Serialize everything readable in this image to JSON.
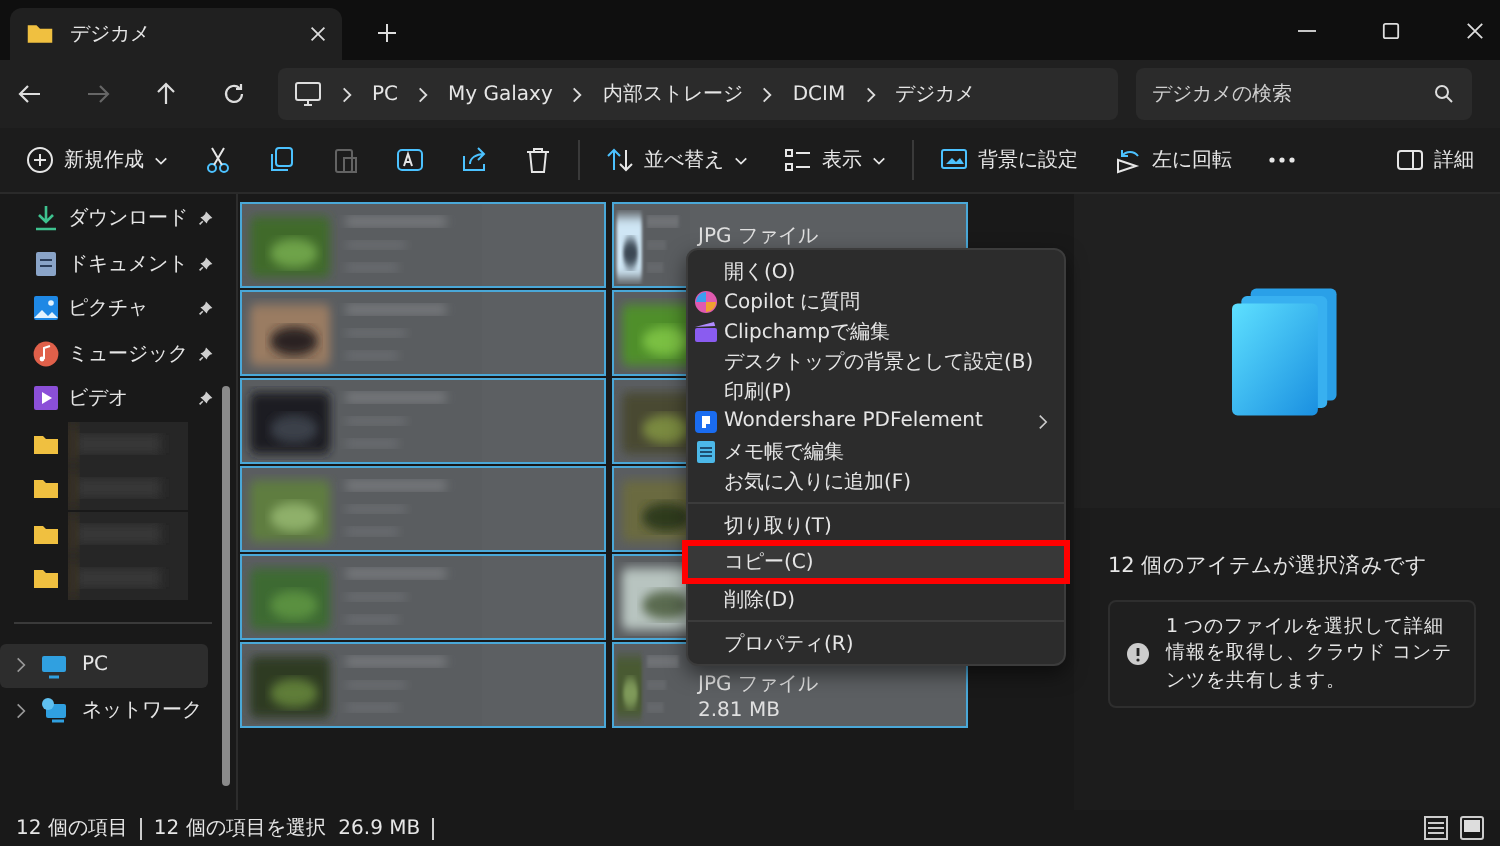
{
  "tab": {
    "title": "デジカメ"
  },
  "address": {
    "crumbs": [
      "PC",
      "My Galaxy",
      "内部ストレージ",
      "DCIM",
      "デジカメ"
    ]
  },
  "search": {
    "placeholder": "デジカメの検索"
  },
  "commands": [
    {
      "kind": "new",
      "label": "新規作成",
      "disabled": false
    },
    {
      "kind": "cut",
      "disabled": false
    },
    {
      "kind": "copy",
      "disabled": false
    },
    {
      "kind": "paste",
      "disabled": true
    },
    {
      "kind": "rename",
      "disabled": false
    },
    {
      "kind": "share",
      "disabled": false
    },
    {
      "kind": "delete",
      "disabled": false
    },
    {
      "kind": "sort",
      "label": "並べ替え",
      "disabled": false
    },
    {
      "kind": "view",
      "label": "表示",
      "disabled": false
    },
    {
      "kind": "background",
      "label": "背景に設定",
      "disabled": false
    },
    {
      "kind": "rotate",
      "label": "左に回転",
      "disabled": false
    },
    {
      "kind": "more",
      "disabled": false
    }
  ],
  "details_button": "詳細",
  "sidebar": {
    "quick": [
      {
        "kind": "download",
        "label": "ダウンロード",
        "pinned": true
      },
      {
        "kind": "documents",
        "label": "ドキュメント",
        "pinned": true
      },
      {
        "kind": "pictures",
        "label": "ピクチャ",
        "pinned": true
      },
      {
        "kind": "music",
        "label": "ミュージック",
        "pinned": true
      },
      {
        "kind": "videos",
        "label": "ビデオ",
        "pinned": true
      },
      {
        "kind": "folder",
        "pinned": false
      },
      {
        "kind": "folder",
        "pinned": false
      },
      {
        "kind": "folder",
        "pinned": false
      },
      {
        "kind": "folder",
        "pinned": false
      }
    ],
    "drives": [
      {
        "kind": "pc",
        "label": "PC",
        "selected": true
      },
      {
        "kind": "network",
        "label": "ネットワーク",
        "selected": false
      }
    ]
  },
  "files": [
    {
      "selected": true
    },
    {
      "selected": true,
      "type": "JPG ファイル"
    },
    {
      "selected": true
    },
    {
      "selected": true
    },
    {
      "selected": true
    },
    {
      "selected": true
    },
    {
      "selected": true
    },
    {
      "selected": true
    },
    {
      "selected": true
    },
    {
      "selected": true
    },
    {
      "selected": true
    },
    {
      "selected": true,
      "type": "JPG ファイル",
      "size": "2.81 MB"
    }
  ],
  "context_menu": [
    {
      "kind": "plain",
      "label": "開く(O)",
      "highlighted": false
    },
    {
      "kind": "copilot",
      "label": "Copilot に質問",
      "highlighted": false
    },
    {
      "kind": "clipchamp",
      "label": "Clipchampで編集",
      "highlighted": false
    },
    {
      "kind": "plain",
      "label": "デスクトップの背景として設定(B)",
      "highlighted": false
    },
    {
      "kind": "plain",
      "label": "印刷(P)",
      "highlighted": false
    },
    {
      "kind": "pdf",
      "label": "Wondershare PDFelement",
      "submenu": true,
      "highlighted": false
    },
    {
      "kind": "notepad",
      "label": "メモ帳で編集",
      "highlighted": false
    },
    {
      "kind": "plain",
      "label": "お気に入りに追加(F)",
      "highlighted": false
    },
    {
      "kind": "separator"
    },
    {
      "kind": "plain",
      "label": "切り取り(T)",
      "highlighted": false
    },
    {
      "kind": "plain",
      "label": "コピー(C)",
      "highlighted": true
    },
    {
      "kind": "plain",
      "label": "削除(D)",
      "highlighted": false
    },
    {
      "kind": "separator"
    },
    {
      "kind": "plain",
      "label": "プロパティ(R)",
      "highlighted": false
    }
  ],
  "details": {
    "title": "12 個のアイテムが選択済みです",
    "info": "1 つのファイルを選択して詳細情報を取得し、クラウド コンテンツを共有します。"
  },
  "status": {
    "count": "12 個の項目",
    "selection": "12 個の項目を選択  26.9 MB"
  }
}
